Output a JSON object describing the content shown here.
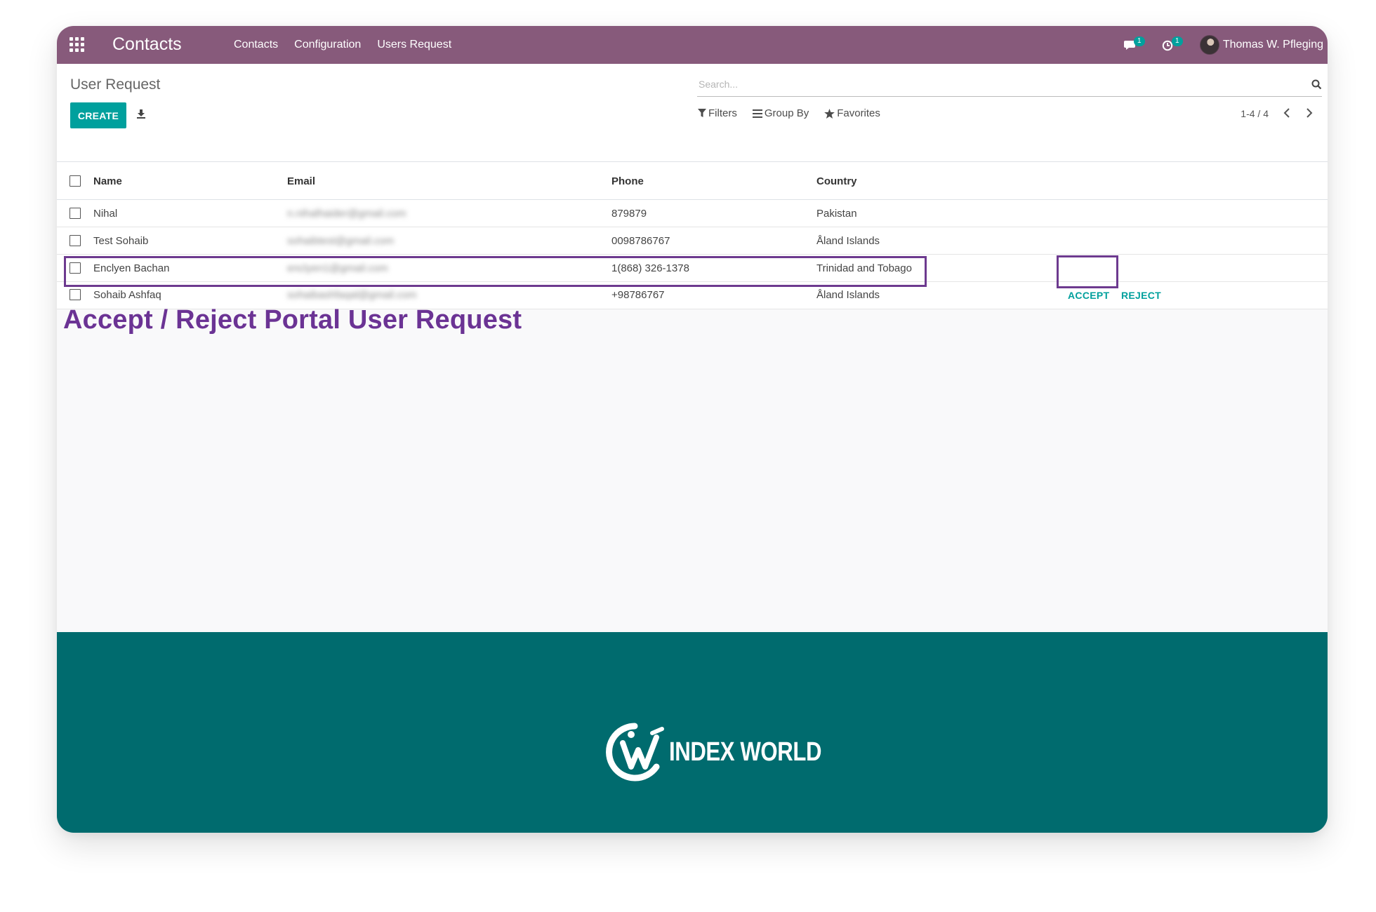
{
  "navbar": {
    "brand": "Contacts",
    "menu": [
      "Contacts",
      "Configuration",
      "Users Request"
    ],
    "messages_badge": "1",
    "activities_badge": "1",
    "user_name": "Thomas W. Pfleging",
    "color": "#875a7b"
  },
  "control_panel": {
    "breadcrumb": "User Request",
    "create_label": "CREATE",
    "search_placeholder": "Search...",
    "filters_label": "Filters",
    "groupby_label": "Group By",
    "favorites_label": "Favorites",
    "pager": "1-4 / 4"
  },
  "table": {
    "columns": [
      "Name",
      "Email",
      "Phone",
      "Country"
    ],
    "rows": [
      {
        "name": "Nihal",
        "email": "n.nihalhaider@gmail.com",
        "phone": "879879",
        "country": "Pakistan"
      },
      {
        "name": "Test Sohaib",
        "email": "sohaibtest@gmail.com",
        "phone": "0098786767",
        "country": "Åland Islands"
      },
      {
        "name": "Enclyen Bachan",
        "email": "enclyen1@gmail.com",
        "phone": "1(868) 326-1378",
        "country": "Trinidad and Tobago"
      },
      {
        "name": "Sohaib Ashfaq",
        "email": "sohaibashfaqal@gmail.com",
        "phone": "+98786767",
        "country": "Åland Islands"
      }
    ],
    "accept_label": "ACCEPT",
    "reject_label": "REJECT"
  },
  "promo_title": "Accept / Reject Portal User Request",
  "footer": {
    "logo_text": "INDEX WORLD",
    "color": "#006b6e"
  },
  "accent_color": "#00a09d"
}
